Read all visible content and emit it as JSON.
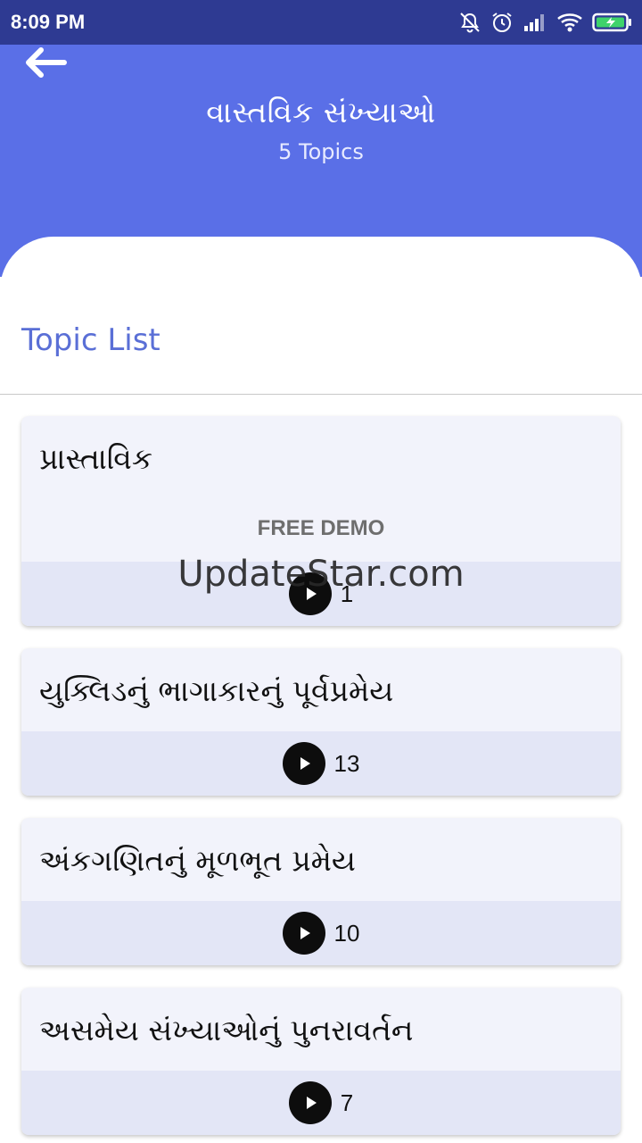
{
  "status_bar": {
    "time": "8:09 PM",
    "icons": [
      "mute-icon",
      "alarm-icon",
      "signal-icon",
      "wifi-icon",
      "battery-charging-icon"
    ]
  },
  "header": {
    "back_icon": "arrow-left-icon",
    "title": "વાસ્તવિક સંખ્યાઓ",
    "subtitle": "5 Topics"
  },
  "section": {
    "title": "Topic List"
  },
  "topics": [
    {
      "name": "પ્રાસ્તાવિક",
      "badge": "FREE DEMO",
      "video_count": "1"
    },
    {
      "name": "યુક્લિડનું ભાગાકારનું પૂર્વપ્રમેય",
      "video_count": "13"
    },
    {
      "name": "અંકગણિતનું મૂળભૂત પ્રમેય",
      "video_count": "10"
    },
    {
      "name": "અસમેય સંખ્યાઓનું પુનરાવર્તન",
      "video_count": "7"
    }
  ],
  "watermark": "UpdateStar.com",
  "colors": {
    "status_bar": "#2e3a92",
    "header": "#5a6fe7",
    "accent_text": "#5a6fd6",
    "card_bg": "#f2f3fb",
    "card_footer": "#e3e6f6"
  }
}
